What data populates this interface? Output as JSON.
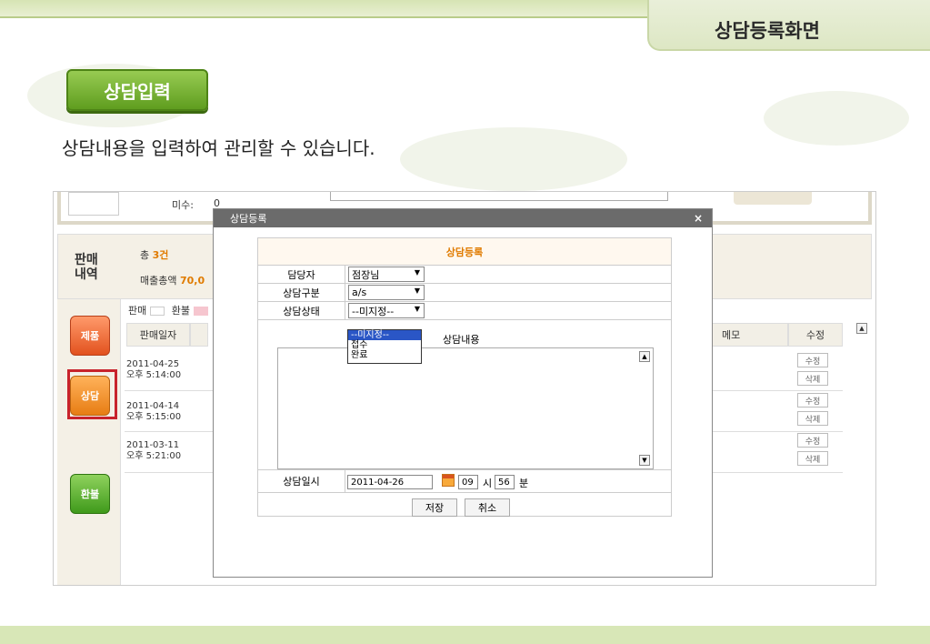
{
  "slide": {
    "title": "상담등록화면",
    "section_button": "상담입력",
    "description": "상담내용을 입력하여 관리할 수 있습니다."
  },
  "app": {
    "top_panel": {
      "label": "미수:",
      "value": "0"
    },
    "sales": {
      "title": "판매\n내역",
      "total_prefix": "총",
      "total_count": "3건",
      "amount_label": "매출총액",
      "amount_value": "70,0"
    },
    "side_buttons": {
      "product": "제품",
      "consult": "상담",
      "refund": "환불"
    },
    "legend": {
      "sale": "판매",
      "refund": "환불"
    },
    "table": {
      "headers": {
        "date": "판매일자",
        "memo": "메모",
        "edit": "수정"
      },
      "rows": [
        {
          "date": "2011-04-25",
          "time": "오후 5:14:00"
        },
        {
          "date": "2011-04-14",
          "time": "오후 5:15:00"
        },
        {
          "date": "2011-03-11",
          "time": "오후 5:21:00"
        }
      ],
      "edit_label": "수정",
      "delete_label": "삭제"
    }
  },
  "dialog": {
    "title": "상담등록",
    "close": "×",
    "form_title": "상담등록",
    "fields": {
      "manager": {
        "label": "담당자",
        "value": "점장님"
      },
      "type": {
        "label": "상담구분",
        "value": "a/s"
      },
      "status": {
        "label": "상담상태",
        "value": "--미지정--",
        "options": [
          "--미지정--",
          "접수",
          "완료"
        ]
      }
    },
    "content_label": "상담내용",
    "datetime": {
      "label": "상담일시",
      "date": "2011-04-26",
      "hour": "09",
      "hour_unit": "시",
      "minute": "56",
      "minute_unit": "분"
    },
    "buttons": {
      "save": "저장",
      "cancel": "취소"
    }
  }
}
